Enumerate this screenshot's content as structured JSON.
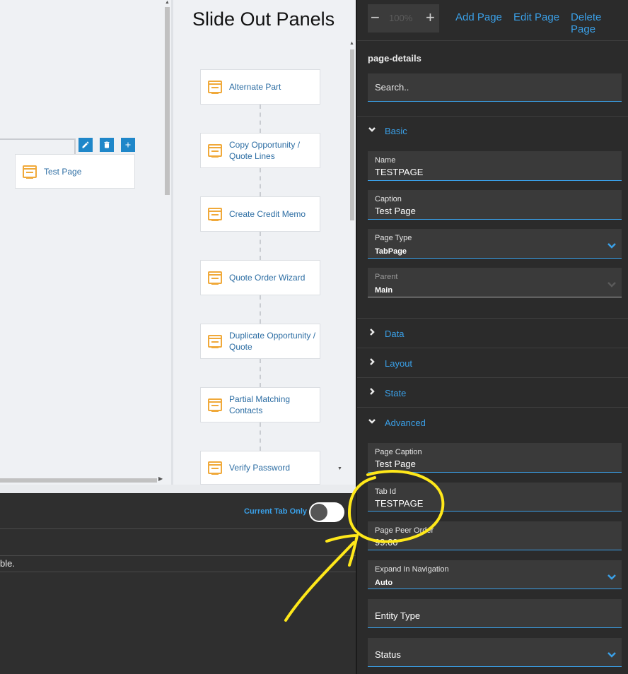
{
  "canvas": {
    "node": {
      "label": "Test Page"
    }
  },
  "slide_panel": {
    "title": "Slide Out Panels",
    "nodes": [
      {
        "label": "Alternate Part"
      },
      {
        "label": "Copy Opportunity / Quote Lines"
      },
      {
        "label": "Create Credit Memo"
      },
      {
        "label": "Quote Order Wizard"
      },
      {
        "label": "Duplicate Opportunity / Quote"
      },
      {
        "label": "Partial Matching Contacts"
      },
      {
        "label": "Verify Password"
      }
    ]
  },
  "bottom_panel": {
    "toggle_label": "Current Tab Only",
    "toggle_on": false,
    "message": "ble."
  },
  "toolbar": {
    "zoom_minus": "−",
    "zoom_value": "100%",
    "zoom_plus": "+",
    "add_page": "Add Page",
    "edit_page": "Edit Page",
    "delete_page": "Delete Page"
  },
  "properties": {
    "title": "page-details",
    "search_placeholder": "Search..",
    "sections": {
      "basic": "Basic",
      "data": "Data",
      "layout": "Layout",
      "state": "State",
      "advanced": "Advanced"
    },
    "basic_fields": {
      "name": {
        "label": "Name",
        "value": "TESTPAGE"
      },
      "caption": {
        "label": "Caption",
        "value": "Test Page"
      },
      "page_type": {
        "label": "Page Type",
        "value": "TabPage"
      },
      "parent": {
        "label": "Parent",
        "value": "Main"
      }
    },
    "advanced_fields": {
      "page_caption": {
        "label": "Page Caption",
        "value": "Test Page"
      },
      "tab_id": {
        "label": "Tab Id",
        "value": "TESTPAGE"
      },
      "page_peer_order": {
        "label": "Page Peer Order",
        "value": "99.00"
      },
      "expand_in_navigation": {
        "label": "Expand In Navigation",
        "value": "Auto"
      },
      "entity_type": {
        "label": "Entity Type"
      },
      "status": {
        "label": "Status"
      }
    }
  },
  "colors": {
    "accent": "#3aa0e8",
    "annotation": "#ffe81a",
    "node_icon": "#f0a93a"
  }
}
